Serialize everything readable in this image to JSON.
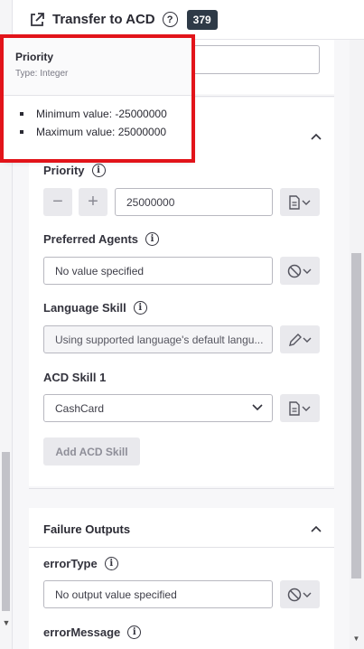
{
  "header": {
    "title": "Transfer to ACD",
    "badge": "379"
  },
  "tooltip": {
    "title": "Priority",
    "type": "Type: Integer",
    "items": [
      "Minimum value: -25000000",
      "Maximum value: 25000000"
    ]
  },
  "fields": {
    "priority": {
      "label": "Priority",
      "value": "25000000"
    },
    "preferred_agents": {
      "label": "Preferred Agents",
      "value": "No value specified"
    },
    "language_skill": {
      "label": "Language Skill",
      "value": "Using supported language's default langu..."
    },
    "acd_skill": {
      "label": "ACD Skill 1",
      "value": "CashCard"
    },
    "add_skill_label": "Add ACD Skill"
  },
  "failure": {
    "title": "Failure Outputs",
    "error_type": {
      "label": "errorType",
      "value": "No output value specified"
    },
    "error_message": {
      "label": "errorMessage"
    }
  },
  "colors": {
    "highlight": "#e2141a",
    "badge_bg": "#2e3a47"
  }
}
